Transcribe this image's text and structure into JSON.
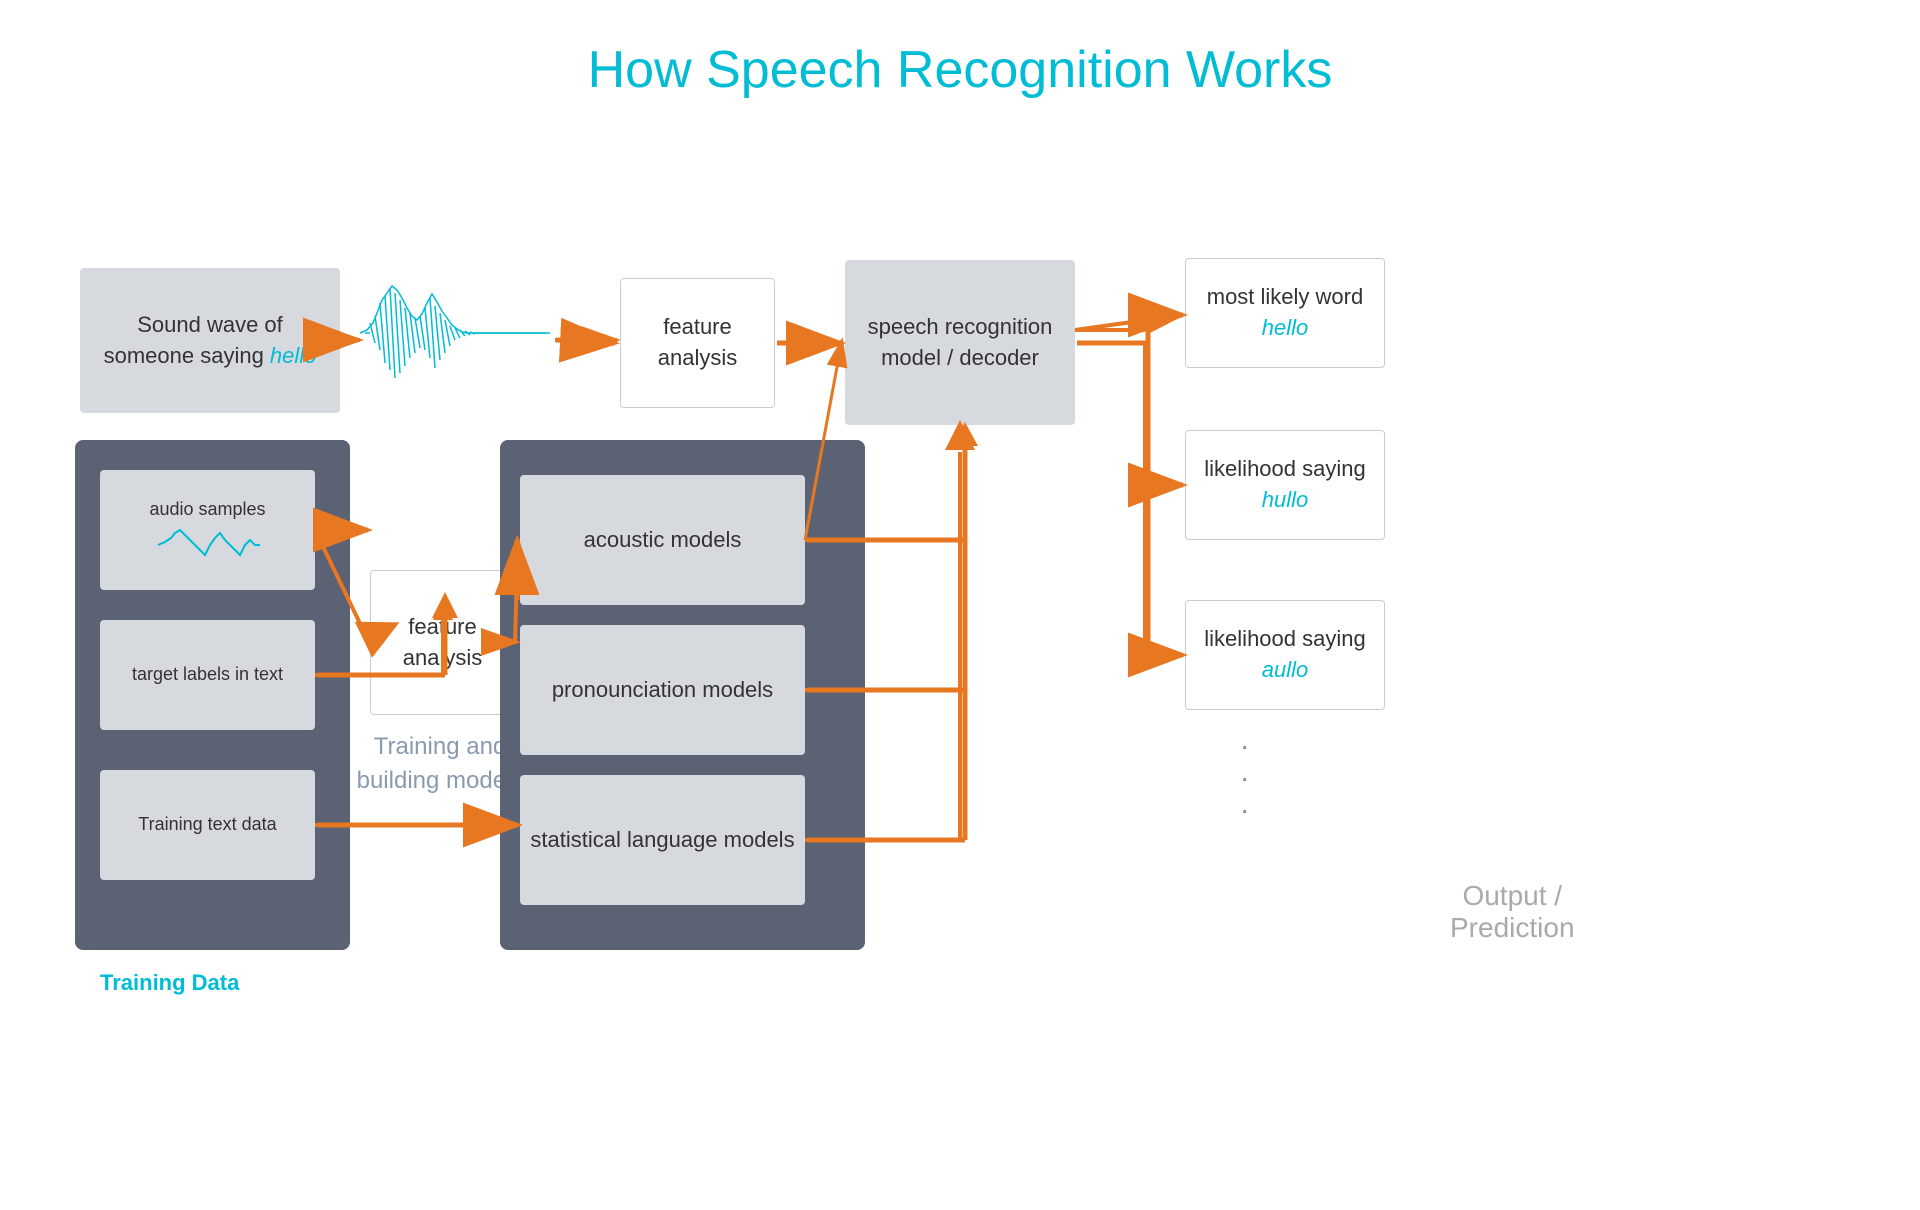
{
  "title": "How Speech Recognition Works",
  "top_row": {
    "sound_wave_label_line1": "Sound wave of",
    "sound_wave_label_line2": "someone saying",
    "sound_wave_italic": "hello",
    "feature_analysis_top": "feature analysis",
    "speech_model_label": "speech recognition model / decoder",
    "most_likely_label": "most likely word",
    "most_likely_italic": "hello",
    "likelihood1_label": "likelihood saying",
    "likelihood1_italic": "hullo",
    "likelihood2_label": "likelihood saying",
    "likelihood2_italic": "aullo"
  },
  "training_block": {
    "audio_samples_label": "audio samples",
    "target_labels_label": "target labels in text",
    "training_text_label": "Training text data",
    "feature_analysis_label": "feature analysis",
    "training_caption": "Training and building models",
    "training_data_label": "Training Data"
  },
  "models_block": {
    "acoustic_label": "acoustic models",
    "pronunciation_label": "pronounciation models",
    "statistical_label": "statistical language models"
  },
  "output": {
    "label": "Output / Prediction",
    "dots": "·   ·   ·"
  }
}
